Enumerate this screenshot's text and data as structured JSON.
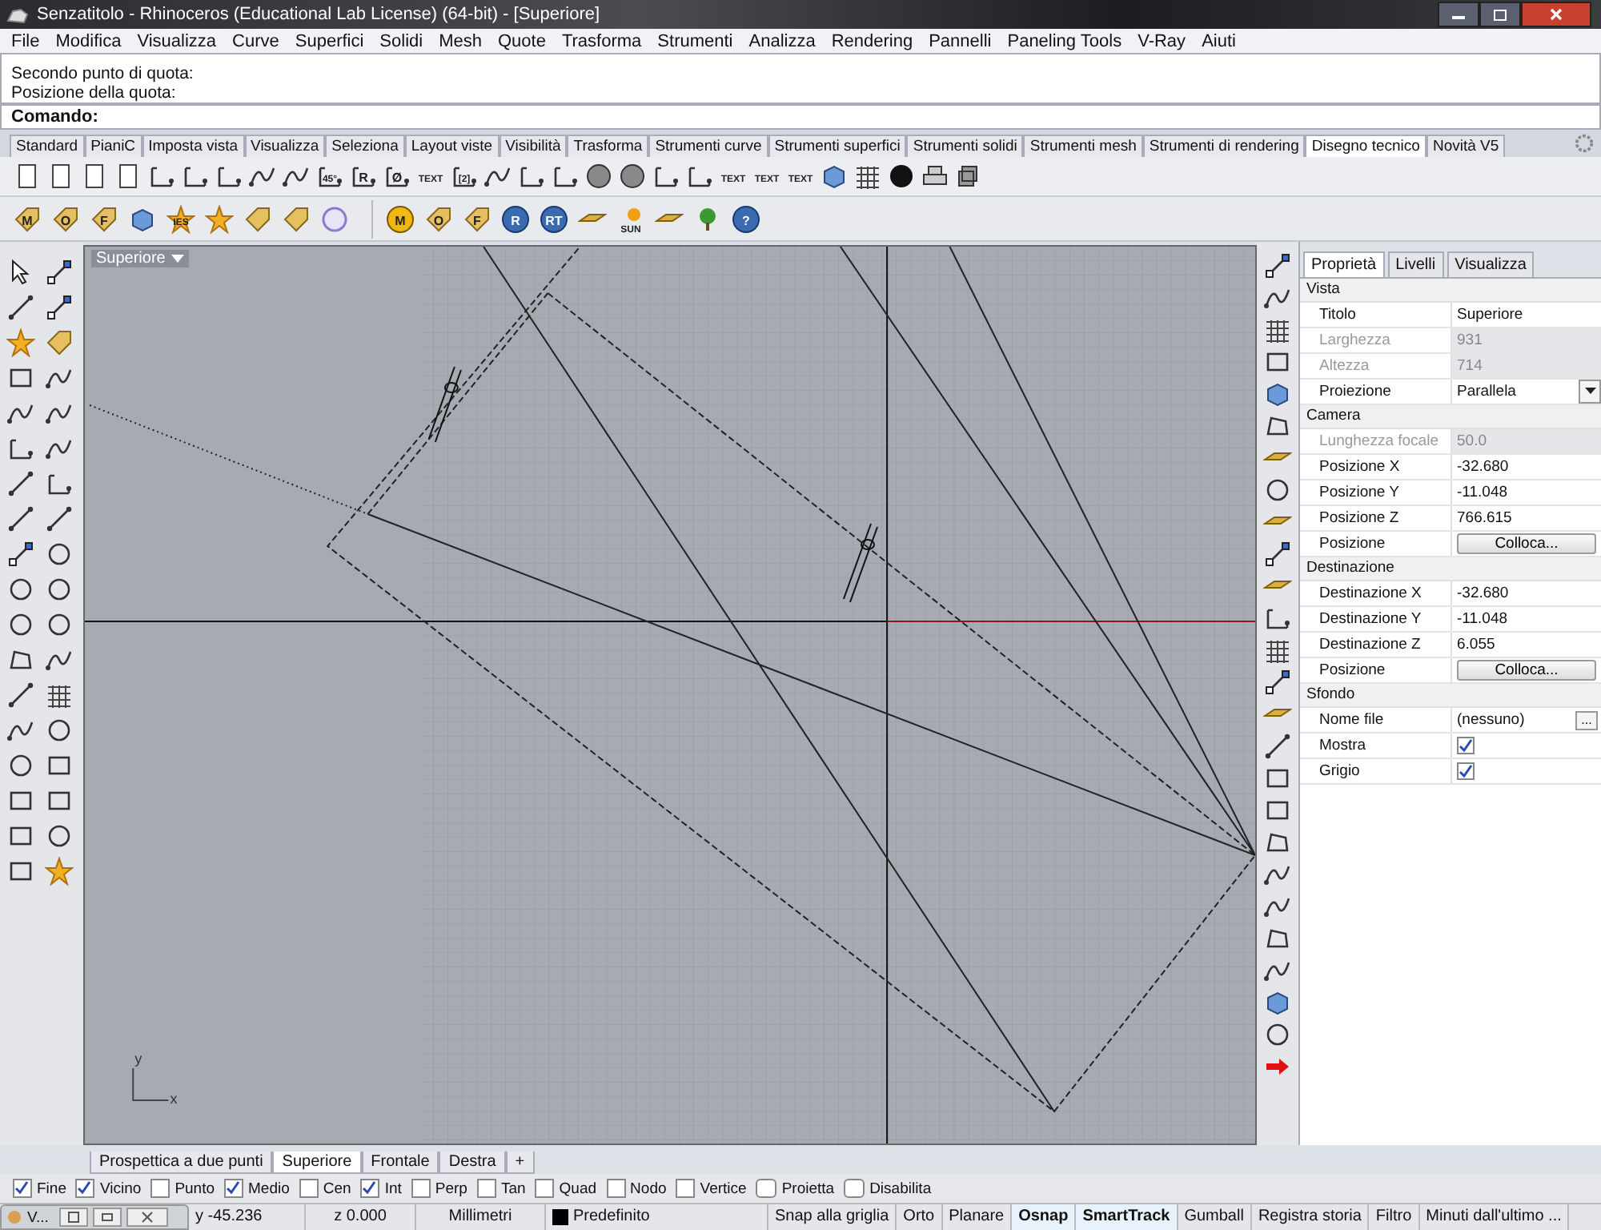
{
  "window": {
    "title": "Senzatitolo - Rhinoceros (Educational Lab License) (64-bit) - [Superiore]"
  },
  "menu": [
    "File",
    "Modifica",
    "Visualizza",
    "Curve",
    "Superfici",
    "Solidi",
    "Mesh",
    "Quote",
    "Trasforma",
    "Strumenti",
    "Analizza",
    "Rendering",
    "Pannelli",
    "Paneling Tools",
    "V-Ray",
    "Aiuti"
  ],
  "command_history": [
    "Secondo punto di quota:",
    "Posizione della quota:"
  ],
  "command_prompt": "Comando:",
  "toolbar_tabs": [
    {
      "label": "Standard",
      "selected": false
    },
    {
      "label": "PianiC",
      "selected": false
    },
    {
      "label": "Imposta vista",
      "selected": false
    },
    {
      "label": "Visualizza",
      "selected": false
    },
    {
      "label": "Seleziona",
      "selected": false
    },
    {
      "label": "Layout viste",
      "selected": false
    },
    {
      "label": "Visibilità",
      "selected": false
    },
    {
      "label": "Trasforma",
      "selected": false
    },
    {
      "label": "Strumenti curve",
      "selected": false
    },
    {
      "label": "Strumenti superfici",
      "selected": false
    },
    {
      "label": "Strumenti solidi",
      "selected": false
    },
    {
      "label": "Strumenti mesh",
      "selected": false
    },
    {
      "label": "Strumenti di rendering",
      "selected": false
    },
    {
      "label": "Disegno tecnico",
      "selected": true
    },
    {
      "label": "Novità V5",
      "selected": false
    }
  ],
  "toolbar_1": [
    {
      "kind": "page"
    },
    {
      "kind": "page"
    },
    {
      "kind": "page"
    },
    {
      "kind": "page"
    },
    {
      "kind": "dim"
    },
    {
      "kind": "dim"
    },
    {
      "kind": "dim"
    },
    {
      "kind": "curve"
    },
    {
      "kind": "curve"
    },
    {
      "kind": "dim",
      "glyph": "45°"
    },
    {
      "kind": "dim",
      "glyph": "R"
    },
    {
      "kind": "dim",
      "glyph": "Ø"
    },
    {
      "kind": "text",
      "glyph": "TEXT"
    },
    {
      "kind": "dim",
      "glyph": "[2]"
    },
    {
      "kind": "curve"
    },
    {
      "kind": "dim"
    },
    {
      "kind": "dim"
    },
    {
      "kind": "hatch"
    },
    {
      "kind": "hatch"
    },
    {
      "kind": "dim"
    },
    {
      "kind": "dim"
    },
    {
      "kind": "text",
      "glyph": "TEXT"
    },
    {
      "kind": "text",
      "glyph": "TEXT"
    },
    {
      "kind": "text",
      "glyph": "TEXT"
    },
    {
      "kind": "cube"
    },
    {
      "kind": "grid"
    },
    {
      "kind": "ball"
    },
    {
      "kind": "printer"
    },
    {
      "kind": "layer"
    }
  ],
  "toolbar_2a": [
    {
      "kind": "tag",
      "glyph": "M"
    },
    {
      "kind": "tag",
      "glyph": "O"
    },
    {
      "kind": "tag",
      "glyph": "F"
    },
    {
      "kind": "cube"
    },
    {
      "kind": "star",
      "glyph": "IES"
    },
    {
      "kind": "star"
    },
    {
      "kind": "tag"
    },
    {
      "kind": "tag"
    },
    {
      "kind": "ring"
    }
  ],
  "toolbar_2b": [
    {
      "kind": "badge",
      "glyph": "M"
    },
    {
      "kind": "tag",
      "glyph": "O"
    },
    {
      "kind": "tag",
      "glyph": "F"
    },
    {
      "kind": "bluebadge",
      "glyph": "R"
    },
    {
      "kind": "bluebadge",
      "glyph": "RT"
    },
    {
      "kind": "plane"
    },
    {
      "kind": "sun",
      "glyph": "SUN"
    },
    {
      "kind": "plane"
    },
    {
      "kind": "tree"
    },
    {
      "kind": "bluebadge",
      "glyph": "?"
    }
  ],
  "viewport": {
    "title": "Superiore",
    "axis_labels": [
      "y",
      "x"
    ]
  },
  "viewport_tabs": [
    {
      "label": "Prospettica a due punti",
      "selected": false
    },
    {
      "label": "Superiore",
      "selected": true
    },
    {
      "label": "Frontale",
      "selected": false
    },
    {
      "label": "Destra",
      "selected": false
    }
  ],
  "add_viewport_tab": "+",
  "panel_tabs": [
    {
      "label": "Proprietà",
      "selected": true
    },
    {
      "label": "Livelli",
      "selected": false
    },
    {
      "label": "Visualizza",
      "selected": false
    }
  ],
  "properties": [
    {
      "section": "Vista",
      "rows": [
        {
          "kind": "text",
          "label": "Titolo",
          "value": "Superiore",
          "disabled": false
        },
        {
          "kind": "text",
          "label": "Larghezza",
          "value": "931",
          "disabled": true
        },
        {
          "kind": "text",
          "label": "Altezza",
          "value": "714",
          "disabled": true
        },
        {
          "kind": "dropdown",
          "label": "Proiezione",
          "value": "Parallela",
          "disabled": false
        }
      ]
    },
    {
      "section": "Camera",
      "rows": [
        {
          "kind": "text",
          "label": "Lunghezza focale",
          "value": "50.0",
          "disabled": true
        },
        {
          "kind": "text",
          "label": "Posizione X",
          "value": "-32.680",
          "disabled": false
        },
        {
          "kind": "text",
          "label": "Posizione Y",
          "value": "-11.048",
          "disabled": false
        },
        {
          "kind": "text",
          "label": "Posizione Z",
          "value": "766.615",
          "disabled": false
        },
        {
          "kind": "button",
          "label": "Posizione",
          "value": "Colloca...",
          "disabled": false
        }
      ]
    },
    {
      "section": "Destinazione",
      "rows": [
        {
          "kind": "text",
          "label": "Destinazione X",
          "value": "-32.680",
          "disabled": false
        },
        {
          "kind": "text",
          "label": "Destinazione Y",
          "value": "-11.048",
          "disabled": false
        },
        {
          "kind": "text",
          "label": "Destinazione Z",
          "value": "6.055",
          "disabled": false
        },
        {
          "kind": "button",
          "label": "Posizione",
          "value": "Colloca...",
          "disabled": false
        }
      ]
    },
    {
      "section": "Sfondo",
      "rows": [
        {
          "kind": "file",
          "label": "Nome file",
          "value": "(nessuno)",
          "button": "...",
          "disabled": false
        },
        {
          "kind": "checkbox",
          "label": "Mostra",
          "checked": true,
          "disabled": false
        },
        {
          "kind": "checkbox",
          "label": "Grigio",
          "checked": true,
          "disabled": false
        }
      ]
    }
  ],
  "osnaps": [
    {
      "label": "Fine",
      "checked": true,
      "kind": "square"
    },
    {
      "label": "Vicino",
      "checked": true,
      "kind": "square"
    },
    {
      "label": "Punto",
      "checked": false,
      "kind": "square"
    },
    {
      "label": "Medio",
      "checked": true,
      "kind": "square"
    },
    {
      "label": "Cen",
      "checked": false,
      "kind": "square"
    },
    {
      "label": "Int",
      "checked": true,
      "kind": "square"
    },
    {
      "label": "Perp",
      "checked": false,
      "kind": "square"
    },
    {
      "label": "Tan",
      "checked": false,
      "kind": "square"
    },
    {
      "label": "Quad",
      "checked": false,
      "kind": "square"
    },
    {
      "label": "Nodo",
      "checked": false,
      "kind": "square"
    },
    {
      "label": "Vertice",
      "checked": false,
      "kind": "square"
    },
    {
      "label": "Proietta",
      "checked": false,
      "kind": "round"
    },
    {
      "label": "Disabilita",
      "checked": false,
      "kind": "round"
    }
  ],
  "mini_window": {
    "title": "V..."
  },
  "status_bar": {
    "y": "y -45.236",
    "z": "z 0.000",
    "units": "Millimetri",
    "layer": "Predefinito",
    "toggles": [
      {
        "label": "Snap alla griglia",
        "on": false
      },
      {
        "label": "Orto",
        "on": false
      },
      {
        "label": "Planare",
        "on": false
      },
      {
        "label": "Osnap",
        "on": true
      },
      {
        "label": "SmartTrack",
        "on": true
      },
      {
        "label": "Gumball",
        "on": false
      },
      {
        "label": "Registra storia",
        "on": false
      },
      {
        "label": "Filtro",
        "on": false
      },
      {
        "label": "Minuti dall'ultimo ...",
        "on": false
      }
    ]
  }
}
